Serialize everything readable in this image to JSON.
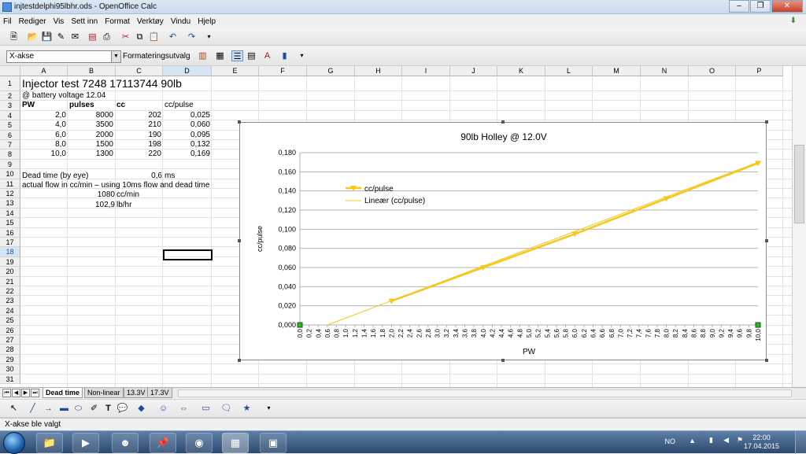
{
  "window": {
    "title": "injtestdelphi95lbhr.ods - OpenOffice Calc"
  },
  "menu": [
    "Fil",
    "Rediger",
    "Vis",
    "Sett inn",
    "Format",
    "Verktøy",
    "Vindu",
    "Hjelp"
  ],
  "namebox": {
    "value": "X-akse"
  },
  "format_button": "Formateringsutvalg",
  "columns": [
    "A",
    "B",
    "C",
    "D",
    "E",
    "F",
    "G",
    "H",
    "I",
    "J",
    "K",
    "L",
    "M",
    "N",
    "O",
    "P"
  ],
  "selected_column": "D",
  "rows": [
    "1",
    "2",
    "3",
    "4",
    "5",
    "6",
    "7",
    "8",
    "9",
    "10",
    "11",
    "12",
    "13",
    "14",
    "15",
    "16",
    "17",
    "18",
    "19",
    "20",
    "21",
    "22",
    "23",
    "24",
    "25",
    "26",
    "27",
    "28",
    "29",
    "30",
    "31"
  ],
  "selected_row": "18",
  "cells": {
    "a1": "Injector test 7248 17113744  90lb",
    "a2": "@ battery voltage 12.04",
    "a3": "PW",
    "b3": "pulses",
    "c3": "cc",
    "d3": "cc/pulse",
    "table": [
      [
        "2,0",
        "8000",
        "202",
        "0,025"
      ],
      [
        "4,0",
        "3500",
        "210",
        "0,060"
      ],
      [
        "6,0",
        "2000",
        "190",
        "0,095"
      ],
      [
        "8,0",
        "1500",
        "198",
        "0,132"
      ],
      [
        "10,0",
        "1300",
        "220",
        "0,169"
      ]
    ],
    "a10": "Dead time (by eye)",
    "c10": "0,6",
    "d10": "ms",
    "a11": "actual flow in cc/min – using 10ms flow and dead time",
    "b12": "1080",
    "c12": "cc/min",
    "b13": "102,9",
    "c13": "lb/hr"
  },
  "chart_data": {
    "type": "line",
    "title": "90lb Holley @ 12.0V",
    "xlabel": "PW",
    "ylabel": "cc/pulse",
    "x": [
      2.0,
      4.0,
      6.0,
      8.0,
      10.0
    ],
    "series": [
      {
        "name": "cc/pulse",
        "values": [
          0.025,
          0.06,
          0.095,
          0.132,
          0.169
        ],
        "color": "#f5c81e"
      },
      {
        "name": "Lineær (cc/pulse)",
        "trend": [
          [
            0.6,
            0
          ],
          [
            10,
            0.17
          ]
        ],
        "color": "#f5c81e"
      }
    ],
    "xlim": [
      0,
      10
    ],
    "ylim": [
      0,
      0.18
    ],
    "yticks": [
      "0,000",
      "0,020",
      "0,040",
      "0,060",
      "0,080",
      "0,100",
      "0,120",
      "0,140",
      "0,160",
      "0,180"
    ],
    "xticks": [
      "0,0",
      "0,2",
      "0,4",
      "0,6",
      "0,8",
      "1,0",
      "1,2",
      "1,4",
      "1,6",
      "1,8",
      "2,0",
      "2,2",
      "2,4",
      "2,6",
      "2,8",
      "3,0",
      "3,2",
      "3,4",
      "3,6",
      "3,8",
      "4,0",
      "4,2",
      "4,4",
      "4,6",
      "4,8",
      "5,0",
      "5,2",
      "5,4",
      "5,6",
      "5,8",
      "6,0",
      "6,2",
      "6,4",
      "6,6",
      "6,8",
      "7,0",
      "7,2",
      "7,4",
      "7,6",
      "7,8",
      "8,0",
      "8,2",
      "8,4",
      "8,6",
      "8,8",
      "9,0",
      "9,2",
      "9,4",
      "9,6",
      "9,8",
      "10,0"
    ],
    "grid": "horizontal",
    "legend": "top-left"
  },
  "sheet_tabs": [
    "Dead time",
    "Non-linear",
    "13.3V",
    "17.3V"
  ],
  "active_tab": "Dead time",
  "status": "X-akse ble valgt",
  "tray": {
    "lang": "NO",
    "time": "22:00",
    "date": "17.04.2015"
  }
}
